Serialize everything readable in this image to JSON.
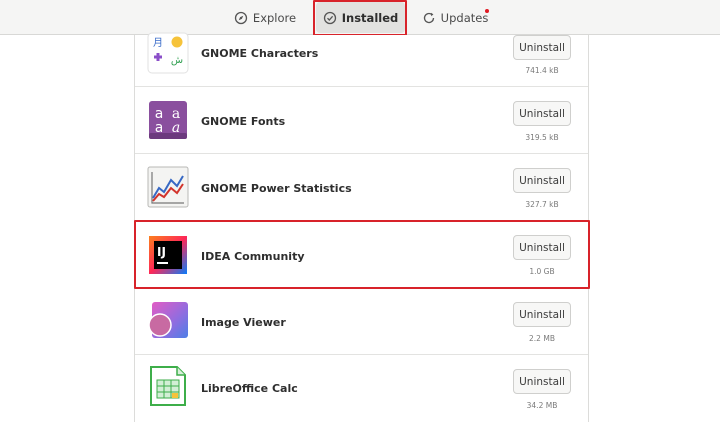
{
  "header": {
    "tabs": [
      {
        "label": "Explore",
        "icon": "compass-icon",
        "active": false
      },
      {
        "label": "Installed",
        "icon": "checkmark-circle-icon",
        "active": true
      },
      {
        "label": "Updates",
        "icon": "refresh-icon",
        "active": false,
        "has_notification_dot": true
      }
    ],
    "notification_dot_color": "#e01b24"
  },
  "apps": [
    {
      "name": "GNOME Characters",
      "button": "Uninstall",
      "size": "741.4 kB",
      "icon": "characters-icon"
    },
    {
      "name": "GNOME Fonts",
      "button": "Uninstall",
      "size": "319.5 kB",
      "icon": "fonts-icon"
    },
    {
      "name": "GNOME Power Statistics",
      "button": "Uninstall",
      "size": "327.7 kB",
      "icon": "power-statistics-icon"
    },
    {
      "name": "IDEA Community",
      "button": "Uninstall",
      "size": "1.0 GB",
      "icon": "intellij-idea-icon"
    },
    {
      "name": "Image Viewer",
      "button": "Uninstall",
      "size": "2.2 MB",
      "icon": "image-viewer-icon"
    },
    {
      "name": "LibreOffice Calc",
      "button": "Uninstall",
      "size": "34.2 MB",
      "icon": "libreoffice-calc-icon"
    }
  ],
  "colors": {
    "highlight": "#d8232a",
    "header_bg": "#f5f5f4",
    "active_tab_bg": "#e2e2e0"
  }
}
